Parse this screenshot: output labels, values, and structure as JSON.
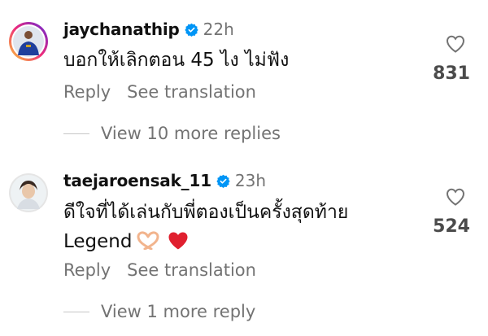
{
  "comments": [
    {
      "username": "jaychanathip",
      "verified_icon": "verified-badge-icon",
      "time": "22h",
      "text": "บอกให้เลิกตอน 45 ไง ไม่ฟัง",
      "reply_label": "Reply",
      "translate_label": "See translation",
      "likes": "831",
      "like_icon": "heart-outline-icon",
      "more_replies": "View 10 more replies"
    },
    {
      "username": "taejaroensak_11",
      "verified_icon": "verified-badge-icon",
      "time": "23h",
      "text_line1": "ดีใจที่ได้เล่นกับพี่ตองเป็นครั้งสุดท้าย",
      "text_line2": "Legend",
      "emojis": [
        "heart-hands-emoji",
        "red-heart-emoji"
      ],
      "reply_label": "Reply",
      "translate_label": "See translation",
      "likes": "524",
      "like_icon": "heart-outline-icon",
      "more_replies": "View 1 more reply"
    }
  ],
  "colors": {
    "verified_blue": "#0095f6",
    "secondary_text": "#737373",
    "story_ring_start": "#f9ce34",
    "story_ring_end": "#ee2a7b"
  }
}
